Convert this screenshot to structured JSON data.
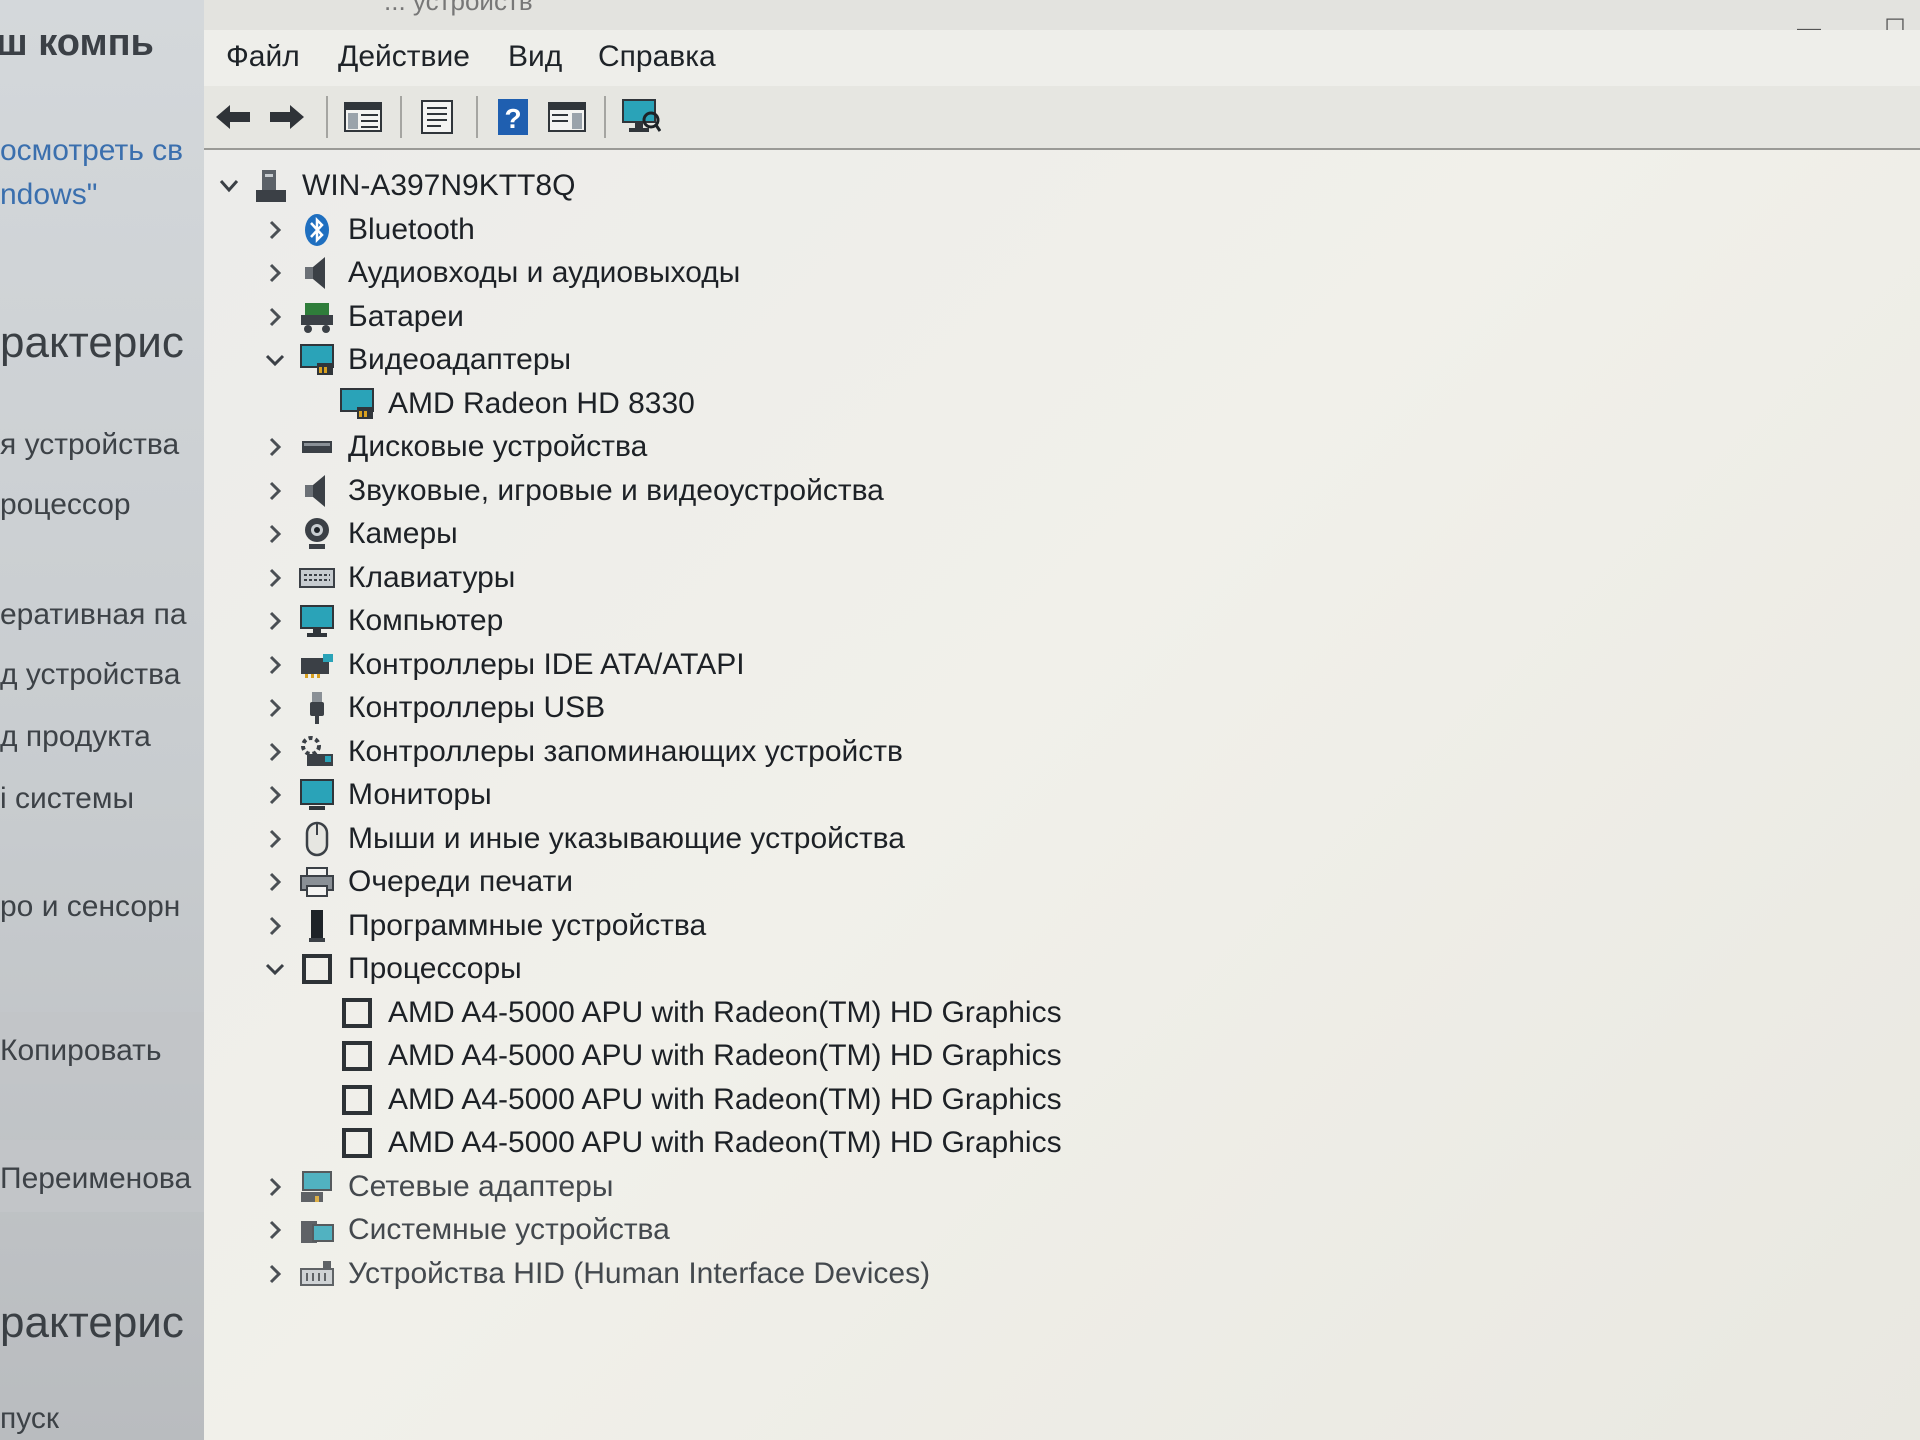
{
  "background_window": {
    "title_fragment": "ш компь",
    "link_lines": [
      "осмотреть св",
      "ndows\""
    ],
    "heading_1": "рактерис",
    "items": [
      "я устройства",
      "роцессор",
      "еративная па",
      "д устройства",
      "д продукта",
      "і системы",
      "ро и сенсорн"
    ],
    "copy_label": "Копировать",
    "rename_label": "Переименова",
    "heading_2": "рактерис",
    "footer_fragment": "пуск"
  },
  "window": {
    "title_fragment": "... устройств",
    "minimize_symbol": "—",
    "maximize_symbol": "☐"
  },
  "menu": {
    "file": "Файл",
    "action": "Действие",
    "view": "Вид",
    "help": "Справка"
  },
  "toolbar": {
    "buttons": [
      "back-icon",
      "forward-icon",
      "console-tree-icon",
      "properties-icon",
      "help-icon",
      "action-pane-icon",
      "scan-hardware-icon"
    ]
  },
  "tree": {
    "root": "WIN-A397N9KTT8Q",
    "nodes": [
      {
        "label": "Bluetooth",
        "icon": "bluetooth-icon",
        "state": "collapsed"
      },
      {
        "label": "Аудиовходы и аудиовыходы",
        "icon": "speaker-icon",
        "state": "collapsed"
      },
      {
        "label": "Батареи",
        "icon": "battery-icon",
        "state": "collapsed"
      },
      {
        "label": "Видеоадаптеры",
        "icon": "display-adapter-icon",
        "state": "expanded",
        "children": [
          "AMD Radeon HD 8330"
        ]
      },
      {
        "label": "Дисковые устройства",
        "icon": "disk-drive-icon",
        "state": "collapsed"
      },
      {
        "label": "Звуковые, игровые и видеоустройства",
        "icon": "sound-icon",
        "state": "collapsed"
      },
      {
        "label": "Камеры",
        "icon": "camera-icon",
        "state": "collapsed"
      },
      {
        "label": "Клавиатуры",
        "icon": "keyboard-icon",
        "state": "collapsed"
      },
      {
        "label": "Компьютер",
        "icon": "computer-icon",
        "state": "collapsed"
      },
      {
        "label": "Контроллеры IDE ATA/ATAPI",
        "icon": "ide-controller-icon",
        "state": "collapsed"
      },
      {
        "label": "Контроллеры USB",
        "icon": "usb-icon",
        "state": "collapsed"
      },
      {
        "label": "Контроллеры запоминающих устройств",
        "icon": "storage-controller-icon",
        "state": "collapsed"
      },
      {
        "label": "Мониторы",
        "icon": "monitor-icon",
        "state": "collapsed"
      },
      {
        "label": "Мыши и иные указывающие устройства",
        "icon": "mouse-icon",
        "state": "collapsed"
      },
      {
        "label": "Очереди печати",
        "icon": "printer-icon",
        "state": "collapsed"
      },
      {
        "label": "Программные устройства",
        "icon": "software-device-icon",
        "state": "collapsed"
      },
      {
        "label": "Процессоры",
        "icon": "processor-icon",
        "state": "expanded",
        "children": [
          "AMD A4-5000 APU with Radeon(TM) HD Graphics",
          "AMD A4-5000 APU with Radeon(TM) HD Graphics",
          "AMD A4-5000 APU with Radeon(TM) HD Graphics",
          "AMD A4-5000 APU with Radeon(TM) HD Graphics"
        ]
      },
      {
        "label": "Сетевые адаптеры",
        "icon": "network-adapter-icon",
        "state": "collapsed"
      },
      {
        "label": "Системные устройства",
        "icon": "system-devices-icon",
        "state": "collapsed"
      },
      {
        "label": "Устройства HID (Human Interface Devices)",
        "icon": "hid-icon",
        "state": "collapsed"
      }
    ]
  },
  "colors": {
    "accent_blue": "#1f6fc0",
    "monitor_teal": "#2aa3b8",
    "tree_background": "#eeede8"
  }
}
